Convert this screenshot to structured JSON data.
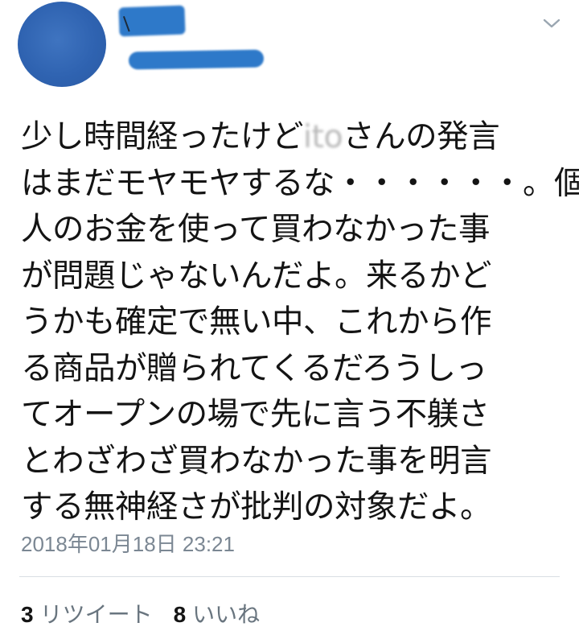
{
  "tweet": {
    "author": {
      "avatar_color": "#2f63b1",
      "name_redaction_color": "#2e79c9"
    },
    "menu_icon": "chevron-down-icon",
    "text_lines": [
      {
        "before": "少し時間経ったけど",
        "redacted": "ito",
        "after": "さんの発言"
      },
      {
        "text": "はまだモヤモヤするな・・・・・・。個"
      },
      {
        "text": "人のお金を使って買わなかった事"
      },
      {
        "text": "が問題じゃないんだよ。来るかど"
      },
      {
        "text": "うかも確定で無い中、これから作"
      },
      {
        "text": "る商品が贈られてくるだろうしっ"
      },
      {
        "text": "てオープンの場で先に言う不躾さ"
      },
      {
        "text": "とわざわざ買わなかった事を明言"
      },
      {
        "text": "する無神経さが批判の対象だよ。"
      }
    ],
    "timestamp": "2018年01月18日 23:21",
    "stats": {
      "retweets_count": "3",
      "retweets_label": "リツイート",
      "likes_count": "8",
      "likes_label": "いいね"
    }
  }
}
